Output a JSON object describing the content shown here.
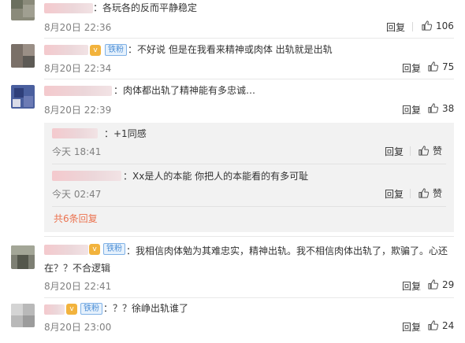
{
  "comments": [
    {
      "text": "：各玩各的反而平静稳定",
      "time": "8月20日 22:36",
      "reply_label": "回复",
      "likes": "106"
    },
    {
      "fan_badge": "铁粉",
      "text": "：不好说 但是在我看来精神或肉体 出轨就是出轨",
      "time": "8月20日 22:34",
      "reply_label": "回复",
      "likes": "75"
    },
    {
      "text": "：肉体都出轨了精神能有多忠诚…",
      "time": "8月20日 22:39",
      "reply_label": "回复",
      "likes": "38",
      "replies": [
        {
          "text": "：+1同感",
          "time": "今天 18:41",
          "reply_label": "回复",
          "like_label": "赞"
        },
        {
          "text": "：Xx是人的本能 你把人的本能看的有多可耻",
          "time": "今天 02:47",
          "reply_label": "回复",
          "like_label": "赞"
        }
      ],
      "more_replies": "共6条回复"
    },
    {
      "fan_badge": "铁粉",
      "text": "：我相信肉体勉为其难忠实，精神出轨。我不相信肉体出轨了，欺骗了。心还在？？不合逻辑",
      "time": "8月20日 22:41",
      "reply_label": "回复",
      "likes": "29"
    },
    {
      "fan_badge": "铁粉",
      "text": "：？？徐峥出轨谁了",
      "time": "8月20日 23:00",
      "reply_label": "回复",
      "likes": "24"
    }
  ],
  "icons": {
    "like": "thumbs-up-icon",
    "vip": "vip-badge-icon"
  },
  "colors": {
    "link": "#eb7350",
    "fan_badge": "#4d8fd6",
    "meta": "#808080"
  }
}
